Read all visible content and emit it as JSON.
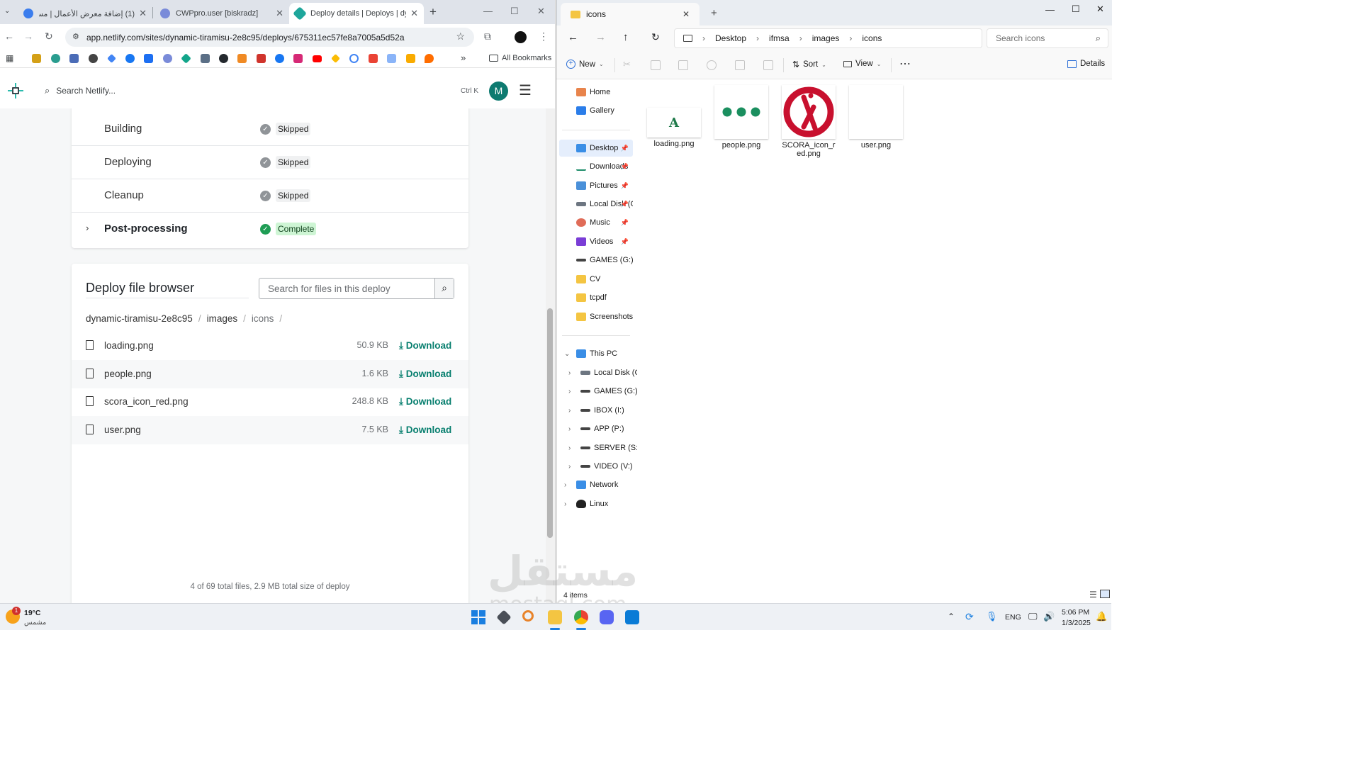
{
  "browser": {
    "tabs": [
      {
        "label": "(1) إضافة معرض الأعمال | مستقل",
        "active": false
      },
      {
        "label": "CWPpro.user [biskradz]",
        "active": false
      },
      {
        "label": "Deploy details | Deploys | dyna",
        "active": true
      }
    ],
    "url": "app.netlify.com/sites/dynamic-tiramisu-2e8c95/deploys/675311ec57fe8a7005a5d52a",
    "all_bookmarks": "All Bookmarks"
  },
  "netlify": {
    "search_placeholder": "Search Netlify...",
    "search_shortcut": "Ctrl K",
    "avatar_letter": "M",
    "steps": [
      {
        "name": "Building",
        "status": "Skipped"
      },
      {
        "name": "Deploying",
        "status": "Skipped"
      },
      {
        "name": "Cleanup",
        "status": "Skipped"
      },
      {
        "name": "Post-processing",
        "status": "Complete"
      }
    ],
    "file_browser": {
      "title": "Deploy file browser",
      "search_placeholder": "Search for files in this deploy",
      "breadcrumb": [
        "dynamic-tiramisu-2e8c95",
        "images",
        "icons"
      ],
      "files": [
        {
          "name": "loading.png",
          "size": "50.9 KB",
          "action": "Download"
        },
        {
          "name": "people.png",
          "size": "1.6 KB",
          "action": "Download"
        },
        {
          "name": "scora_icon_red.png",
          "size": "248.8 KB",
          "action": "Download"
        },
        {
          "name": "user.png",
          "size": "7.5 KB",
          "action": "Download"
        }
      ],
      "summary": "4 of 69 total files, 2.9 MB total size of deploy"
    }
  },
  "explorer": {
    "tab_title": "icons",
    "breadcrumb": [
      "Desktop",
      "ifmsa",
      "images",
      "icons"
    ],
    "search_placeholder": "Search icons",
    "commands": {
      "new": "New",
      "sort": "Sort",
      "view": "View",
      "details": "Details"
    },
    "quick": [
      {
        "label": "Home"
      },
      {
        "label": "Gallery"
      }
    ],
    "pinned": [
      {
        "label": "Desktop"
      },
      {
        "label": "Downloads"
      },
      {
        "label": "Pictures"
      },
      {
        "label": "Local Disk (C:"
      },
      {
        "label": "Music"
      },
      {
        "label": "Videos"
      },
      {
        "label": "GAMES (G:)"
      },
      {
        "label": "CV"
      },
      {
        "label": "tcpdf"
      },
      {
        "label": "Screenshots"
      }
    ],
    "this_pc": "This PC",
    "drives": [
      {
        "label": "Local Disk (C:"
      },
      {
        "label": "GAMES (G:)"
      },
      {
        "label": "IBOX (I:)"
      },
      {
        "label": "APP (P:)"
      },
      {
        "label": "SERVER (S:)"
      },
      {
        "label": "VIDEO (V:)"
      }
    ],
    "network": "Network",
    "linux": "Linux",
    "files": [
      {
        "name": "loading.png"
      },
      {
        "name": "people.png"
      },
      {
        "name": "SCORA_icon_red.png"
      },
      {
        "name": "user.png"
      }
    ],
    "status": "4 items"
  },
  "taskbar": {
    "weather_temp": "19°C",
    "weather_desc": "مشمس",
    "notification_count": "1",
    "language": "ENG",
    "time": "5:06 PM",
    "date": "1/3/2025"
  },
  "watermark": {
    "line1": "مستقل",
    "line2": "mostaql.com"
  },
  "colors": {
    "netlify_teal": "#087f6f",
    "complete_green": "#cef5d4",
    "scora_red": "#c8102e"
  }
}
